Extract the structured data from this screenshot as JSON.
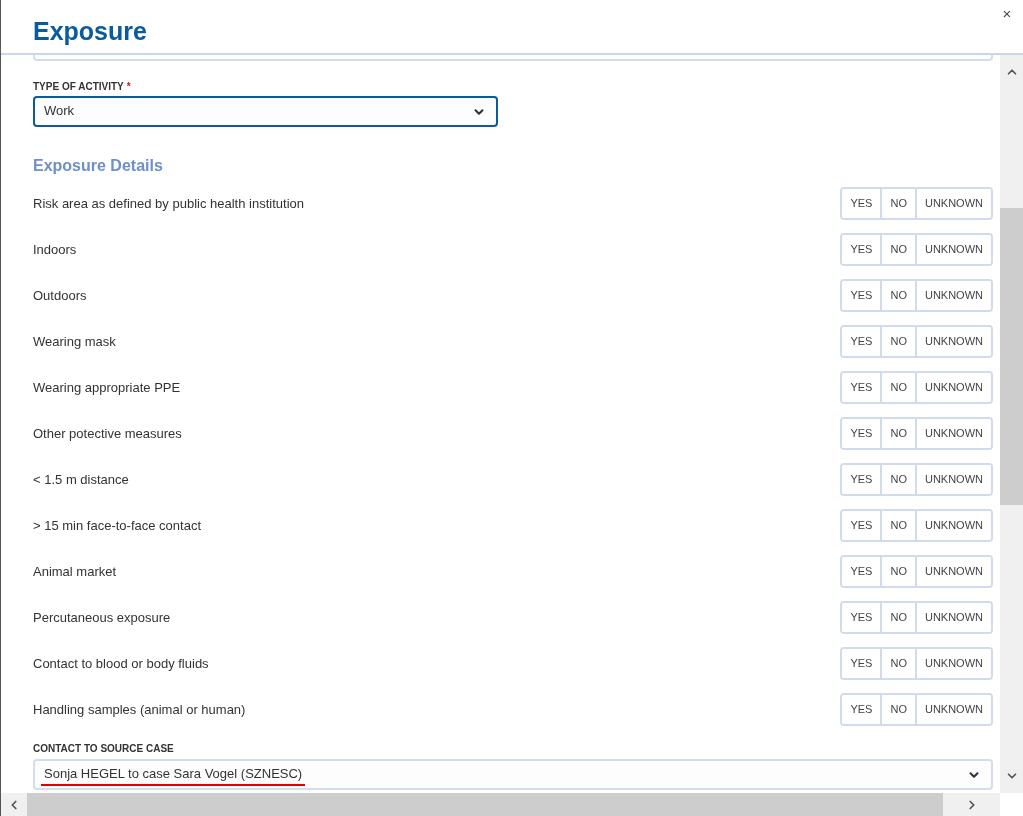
{
  "dialog": {
    "title": "Exposure",
    "close": "×"
  },
  "activity_field": {
    "label": "TYPE OF ACTIVITY",
    "required_mark": "*",
    "value": "Work",
    "focused": true
  },
  "section": {
    "title": "Exposure Details"
  },
  "questions": [
    {
      "label": "Risk area as defined by public health institution",
      "options": [
        {
          "label": "YES",
          "selected": false
        },
        {
          "label": "NO",
          "selected": false
        },
        {
          "label": "UNKNOWN",
          "selected": false
        }
      ]
    },
    {
      "label": "Indoors",
      "options": [
        {
          "label": "YES",
          "selected": false
        },
        {
          "label": "NO",
          "selected": false
        },
        {
          "label": "UNKNOWN",
          "selected": false
        }
      ]
    },
    {
      "label": "Outdoors",
      "options": [
        {
          "label": "YES",
          "selected": false
        },
        {
          "label": "NO",
          "selected": false
        },
        {
          "label": "UNKNOWN",
          "selected": false
        }
      ]
    },
    {
      "label": "Wearing mask",
      "options": [
        {
          "label": "YES",
          "selected": false
        },
        {
          "label": "NO",
          "selected": false
        },
        {
          "label": "UNKNOWN",
          "selected": false
        }
      ]
    },
    {
      "label": "Wearing appropriate PPE",
      "options": [
        {
          "label": "YES",
          "selected": false
        },
        {
          "label": "NO",
          "selected": false
        },
        {
          "label": "UNKNOWN",
          "selected": false
        }
      ]
    },
    {
      "label": "Other potective measures",
      "options": [
        {
          "label": "YES",
          "selected": false
        },
        {
          "label": "NO",
          "selected": false
        },
        {
          "label": "UNKNOWN",
          "selected": false
        }
      ]
    },
    {
      "label": "< 1.5 m distance",
      "options": [
        {
          "label": "YES",
          "selected": false
        },
        {
          "label": "NO",
          "selected": false
        },
        {
          "label": "UNKNOWN",
          "selected": false
        }
      ]
    },
    {
      "label": "> 15 min face-to-face contact",
      "options": [
        {
          "label": "YES",
          "selected": false
        },
        {
          "label": "NO",
          "selected": false
        },
        {
          "label": "UNKNOWN",
          "selected": false
        }
      ]
    },
    {
      "label": "Animal market",
      "options": [
        {
          "label": "YES",
          "selected": false
        },
        {
          "label": "NO",
          "selected": false
        },
        {
          "label": "UNKNOWN",
          "selected": false
        }
      ]
    },
    {
      "label": "Percutaneous exposure",
      "options": [
        {
          "label": "YES",
          "selected": false
        },
        {
          "label": "NO",
          "selected": false
        },
        {
          "label": "UNKNOWN",
          "selected": false
        }
      ]
    },
    {
      "label": "Contact to blood or body fluids",
      "options": [
        {
          "label": "YES",
          "selected": false
        },
        {
          "label": "NO",
          "selected": false
        },
        {
          "label": "UNKNOWN",
          "selected": false
        }
      ]
    },
    {
      "label": "Handling samples (animal or human)",
      "options": [
        {
          "label": "YES",
          "selected": false
        },
        {
          "label": "NO",
          "selected": false
        },
        {
          "label": "UNKNOWN",
          "selected": false
        }
      ]
    }
  ],
  "contact_field": {
    "label": "CONTACT TO SOURCE CASE",
    "value": "Sonja HEGEL to case Sara Vogel (SZNESC)",
    "focused": false,
    "underlined": true
  }
}
